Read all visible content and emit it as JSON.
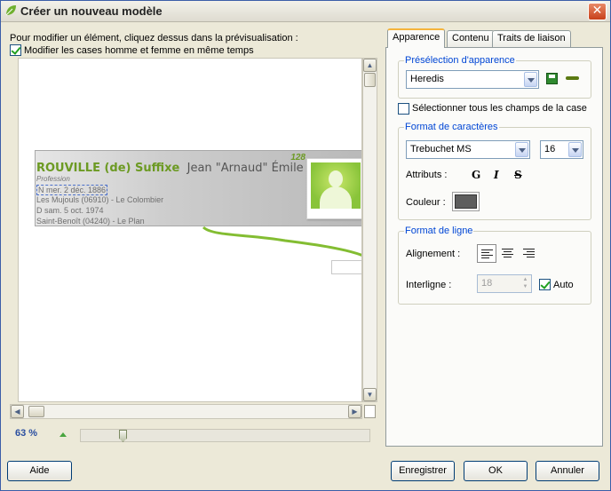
{
  "window": {
    "title": "Créer un nouveau modèle"
  },
  "intro": "Pour modifier un élément, cliquez dessus dans la prévisualisation :",
  "sync_checkbox": {
    "label": "Modifier les cases homme et femme en même temps",
    "checked": true
  },
  "preview": {
    "card": {
      "number": "128",
      "surname": "ROUVILLE (de) Suffixe",
      "given_names": "Jean \"Arnaud\" Émile Surnom",
      "profession": "Profession",
      "lines": [
        "N mer. 2 déc. 1886",
        "Les Mujouls (06910) - Le Colombier",
        "D sam. 5 oct. 1974",
        "Saint-Benoît (04240) - Le Plan"
      ]
    }
  },
  "zoom": {
    "label": "63 %"
  },
  "tabs": [
    {
      "label": "Apparence",
      "active": true
    },
    {
      "label": "Contenu",
      "active": false
    },
    {
      "label": "Traits de liaison",
      "active": false
    }
  ],
  "preselection": {
    "legend": "Présélection d'apparence",
    "value": "Heredis"
  },
  "select_all": {
    "label": "Sélectionner tous les champs de la case",
    "checked": false
  },
  "char_format": {
    "legend": "Format de caractères",
    "font": "Trebuchet MS",
    "size": "16",
    "attributes_label": "Attributs :",
    "bold_label": "G",
    "italic_label": "I",
    "strike_label": "S",
    "color_label": "Couleur :",
    "color": "#5d5d5d"
  },
  "line_format": {
    "legend": "Format de ligne",
    "alignment_label": "Alignement :",
    "alignment_selected": "left",
    "spacing_label": "Interligne :",
    "spacing_value": "18",
    "auto_label": "Auto",
    "auto_checked": true
  },
  "buttons": {
    "help": "Aide",
    "save": "Enregistrer",
    "ok": "OK",
    "cancel": "Annuler"
  },
  "colors": {
    "accent_green": "#6c9a23",
    "legend_blue": "#0046d5",
    "tab_highlight": "#f5b43b"
  }
}
